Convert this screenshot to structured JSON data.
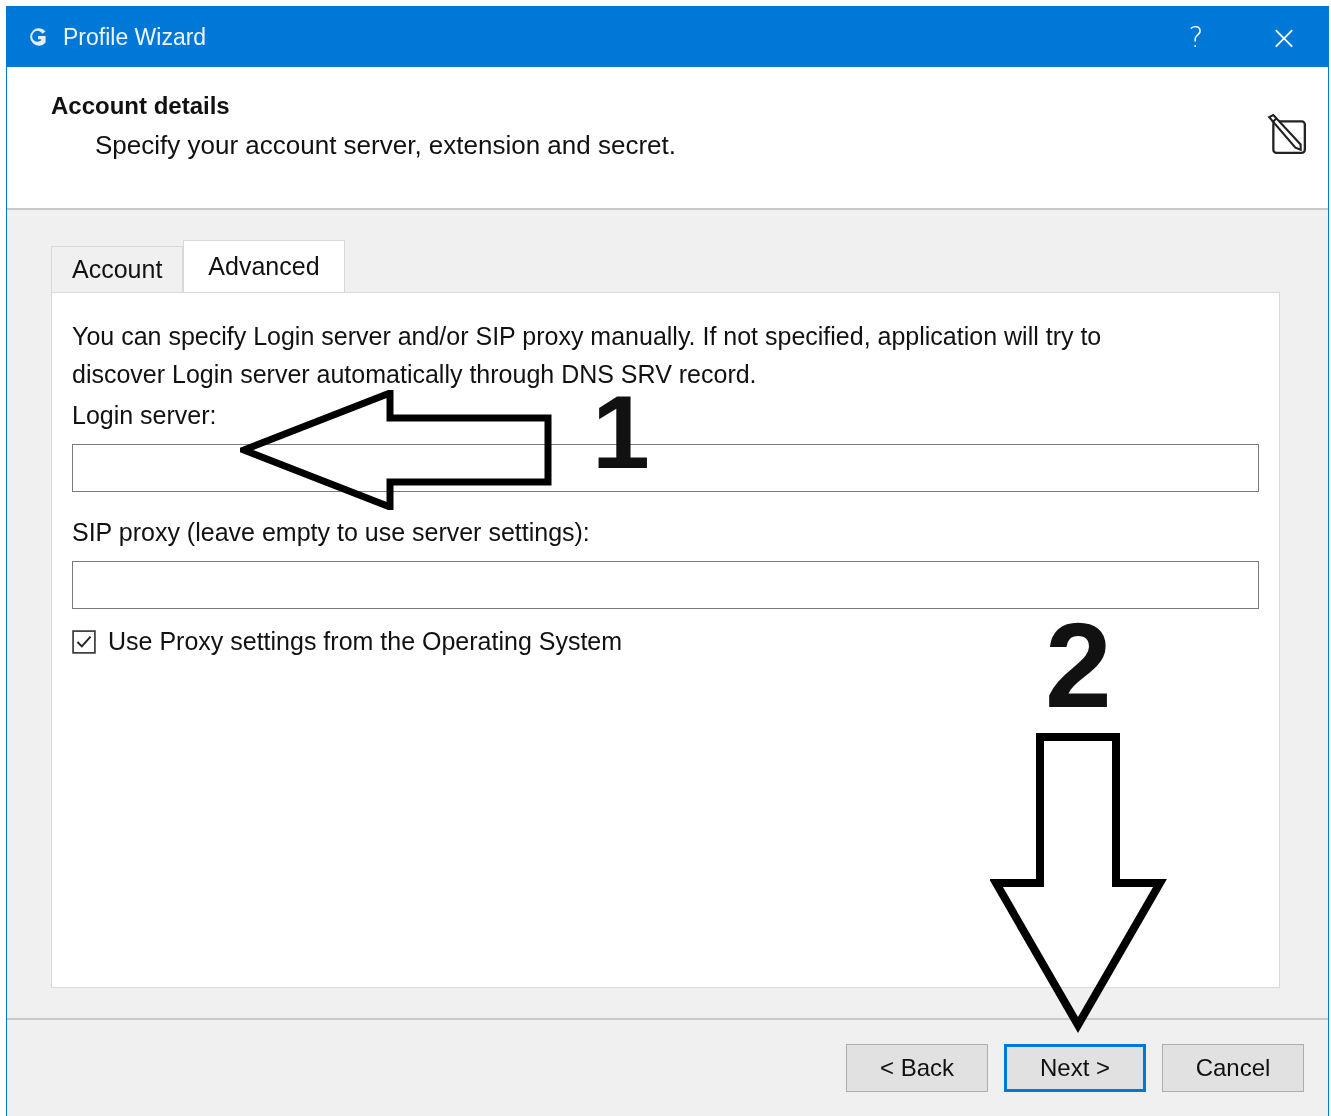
{
  "window": {
    "title": "Profile Wizard",
    "help_button": "?",
    "close_button": "×"
  },
  "header": {
    "title": "Account details",
    "subtitle": "Specify your account server, extension and secret."
  },
  "tabs": [
    {
      "label": "Account",
      "selected": false
    },
    {
      "label": "Advanced",
      "selected": true
    }
  ],
  "panel": {
    "description": "You can specify Login server and/or SIP proxy manually. If not specified, application will try to discover Login server automatically through DNS SRV record.",
    "fields": [
      {
        "label": "Login server:"
      },
      {
        "label": "SIP proxy (leave empty to use server settings):"
      }
    ],
    "checkbox": {
      "label": "Use Proxy settings from the Operating System",
      "checked": true
    }
  },
  "buttons": [
    {
      "label": "< Back",
      "focused": false
    },
    {
      "label": "Next >",
      "focused": true
    },
    {
      "label": "Cancel",
      "focused": false
    }
  ],
  "annotations": [
    {
      "kind": "left",
      "number": "1"
    },
    {
      "kind": "down",
      "number": "2"
    }
  ]
}
